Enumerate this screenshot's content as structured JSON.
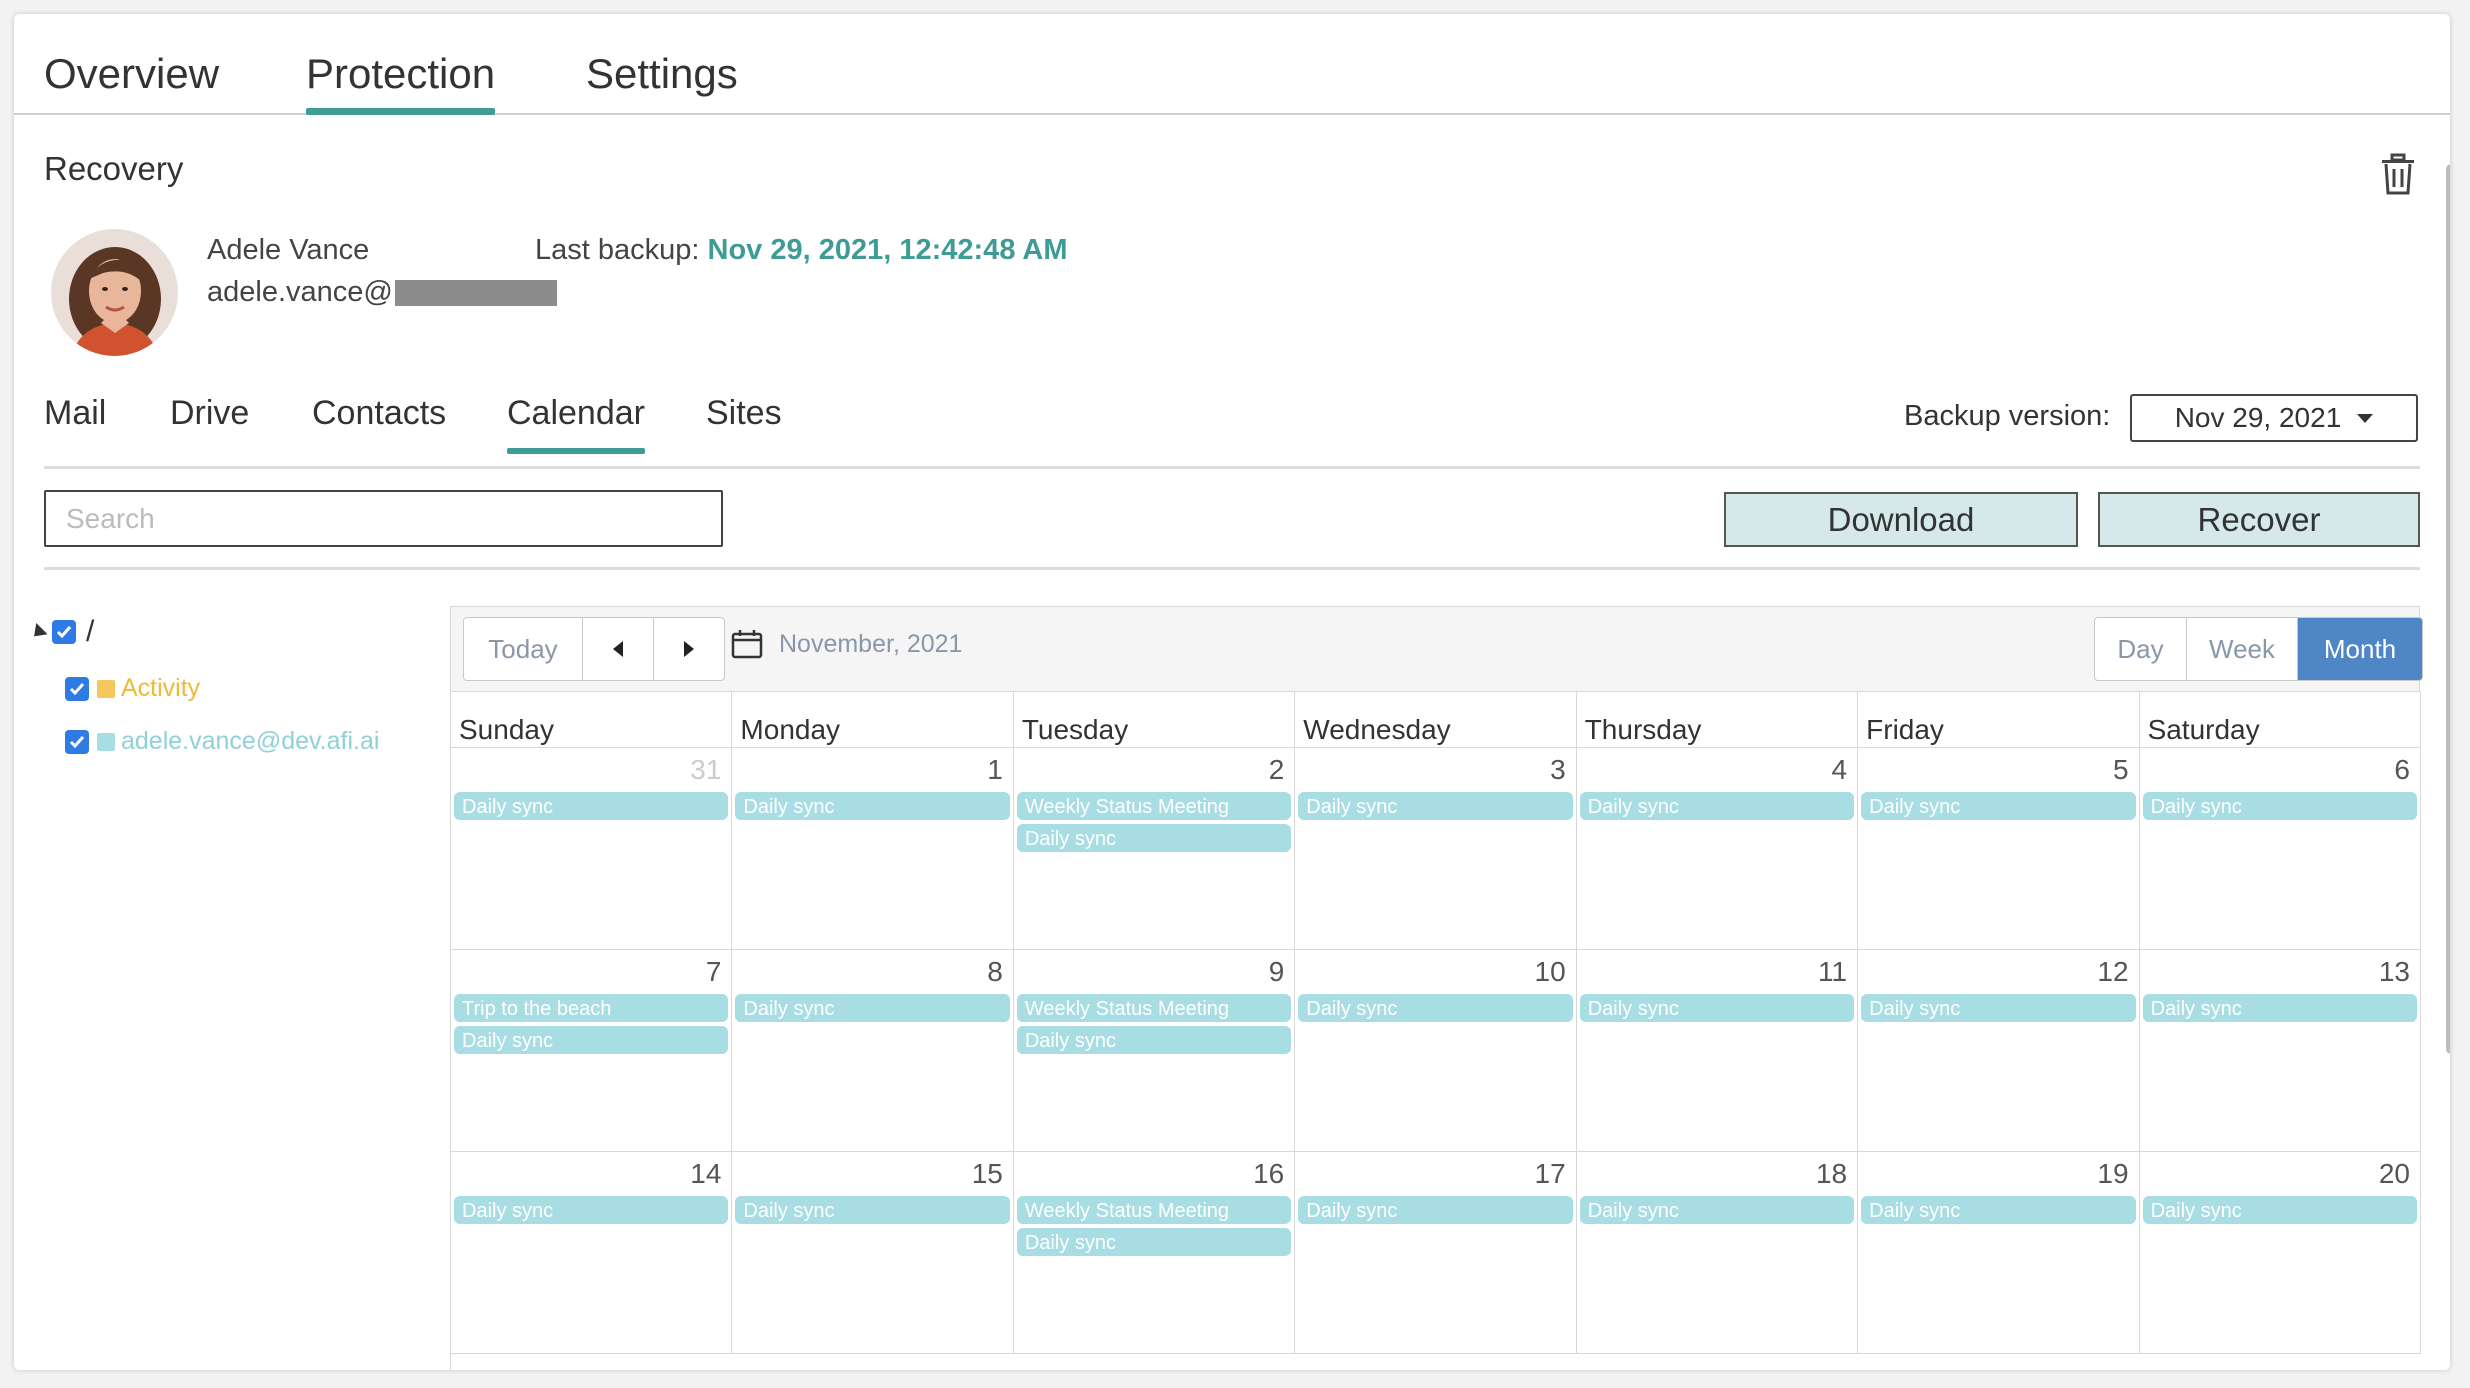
{
  "top_tabs": [
    {
      "label": "Overview"
    },
    {
      "label": "Protection",
      "active": true
    },
    {
      "label": "Settings"
    }
  ],
  "section_title": "Recovery",
  "user": {
    "name": "Adele Vance",
    "email_prefix": "adele.vance@"
  },
  "last_backup": {
    "label": "Last backup:",
    "value": "Nov 29, 2021, 12:42:48 AM"
  },
  "sub_tabs": [
    {
      "label": "Mail"
    },
    {
      "label": "Drive"
    },
    {
      "label": "Contacts"
    },
    {
      "label": "Calendar",
      "active": true
    },
    {
      "label": "Sites"
    }
  ],
  "backup_version": {
    "label": "Backup version:",
    "value": "Nov 29, 2021"
  },
  "search": {
    "placeholder": "Search",
    "value": ""
  },
  "actions": {
    "download": "Download",
    "recover": "Recover"
  },
  "tree": {
    "root": "/",
    "items": [
      {
        "label": "Activity",
        "color": "#f5c85f",
        "text_color": "#f0b93a"
      },
      {
        "label": "adele.vance@dev.afi.ai",
        "color": "#a8dde3",
        "text_color": "#8fd0da"
      }
    ]
  },
  "calendar": {
    "today": "Today",
    "month_label": "November, 2021",
    "views": [
      {
        "label": "Day"
      },
      {
        "label": "Week"
      },
      {
        "label": "Month",
        "active": true
      }
    ],
    "weekdays": [
      "Sunday",
      "Monday",
      "Tuesday",
      "Wednesday",
      "Thursday",
      "Friday",
      "Saturday"
    ],
    "weeks": [
      [
        {
          "day": "31",
          "other": true,
          "events": [
            "Daily sync"
          ]
        },
        {
          "day": "1",
          "events": [
            "Daily sync"
          ]
        },
        {
          "day": "2",
          "events": [
            "Weekly Status Meeting",
            "Daily sync"
          ]
        },
        {
          "day": "3",
          "events": [
            "Daily sync"
          ]
        },
        {
          "day": "4",
          "events": [
            "Daily sync"
          ]
        },
        {
          "day": "5",
          "events": [
            "Daily sync"
          ]
        },
        {
          "day": "6",
          "events": [
            "Daily sync"
          ]
        }
      ],
      [
        {
          "day": "7",
          "events": [
            "Trip to the beach",
            "Daily sync"
          ]
        },
        {
          "day": "8",
          "events": [
            "Daily sync"
          ]
        },
        {
          "day": "9",
          "events": [
            "Weekly Status Meeting",
            "Daily sync"
          ]
        },
        {
          "day": "10",
          "events": [
            "Daily sync"
          ]
        },
        {
          "day": "11",
          "events": [
            "Daily sync"
          ]
        },
        {
          "day": "12",
          "events": [
            "Daily sync"
          ]
        },
        {
          "day": "13",
          "events": [
            "Daily sync"
          ]
        }
      ],
      [
        {
          "day": "14",
          "events": [
            "Daily sync"
          ]
        },
        {
          "day": "15",
          "events": [
            "Daily sync"
          ]
        },
        {
          "day": "16",
          "events": [
            "Weekly Status Meeting",
            "Daily sync"
          ]
        },
        {
          "day": "17",
          "events": [
            "Daily sync"
          ]
        },
        {
          "day": "18",
          "events": [
            "Daily sync"
          ]
        },
        {
          "day": "19",
          "events": [
            "Daily sync"
          ]
        },
        {
          "day": "20",
          "events": [
            "Daily sync"
          ]
        }
      ]
    ]
  },
  "colors": {
    "accent": "#3f9b96",
    "event": "#a8dde3",
    "active_view": "#4f86c6",
    "button_bg": "#d5e9ea"
  }
}
